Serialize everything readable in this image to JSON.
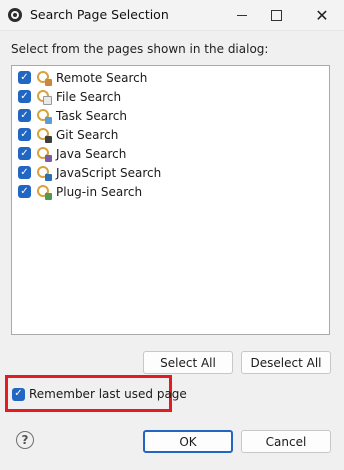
{
  "window": {
    "title": "Search Page Selection"
  },
  "dialog": {
    "prompt": "Select from the pages shown in the dialog:",
    "pages": [
      {
        "label": "Remote Search",
        "checked": true
      },
      {
        "label": "File Search",
        "checked": true
      },
      {
        "label": "Task Search",
        "checked": true
      },
      {
        "label": "Git Search",
        "checked": true
      },
      {
        "label": "Java Search",
        "checked": true
      },
      {
        "label": "JavaScript Search",
        "checked": true
      },
      {
        "label": "Plug-in Search",
        "checked": true
      }
    ],
    "select_all_label": "Select All",
    "deselect_all_label": "Deselect All",
    "remember_label": "Remember last used page",
    "remember_checked": true,
    "ok_label": "OK",
    "cancel_label": "Cancel"
  },
  "colors": {
    "checkbox_accent": "#2266c4",
    "highlight_frame": "#e31b23"
  }
}
